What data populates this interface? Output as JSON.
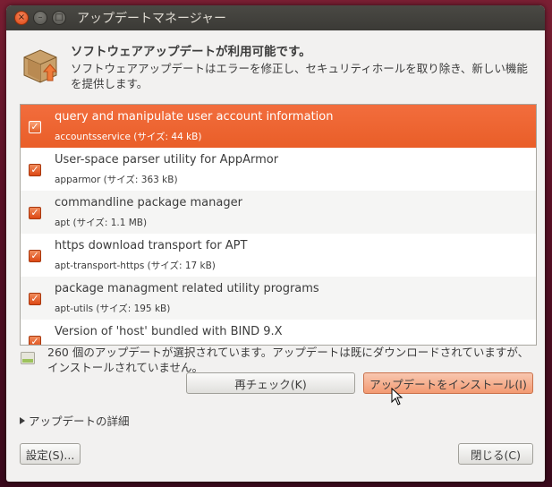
{
  "window": {
    "title": "アップデートマネージャー"
  },
  "header": {
    "heading": "ソフトウェアアップデートが利用可能です。",
    "description": "ソフトウェアアップデートはエラーを修正し、セキュリティホールを取り除き、新しい機能を提供します。"
  },
  "updates": [
    {
      "title": "query and manipulate user account information",
      "subtitle": "accountsservice (サイズ: 44 kB)"
    },
    {
      "title": "User-space parser utility for AppArmor",
      "subtitle": "apparmor (サイズ: 363 kB)"
    },
    {
      "title": "commandline package manager",
      "subtitle": "apt (サイズ: 1.1 MB)"
    },
    {
      "title": "https download transport for APT",
      "subtitle": "apt-transport-https (サイズ: 17 kB)"
    },
    {
      "title": "package managment related utility programs",
      "subtitle": "apt-utils (サイズ: 195 kB)"
    },
    {
      "title": "Version of 'host' bundled with BIND 9.X",
      "subtitle": ""
    }
  ],
  "status": {
    "text": "260 個のアップデートが選択されています。アップデートは既にダウンロードされていますが、インストールされていません。"
  },
  "buttons": {
    "check": "再チェック(K)",
    "install": "アップデートをインストール(I)",
    "settings": "設定(S)...",
    "close": "閉じる(C)"
  },
  "details_label": "アップデートの詳細",
  "colors": {
    "accent": "#e95e28",
    "titlebar": "#3b3a36",
    "window_bg": "#f2f1f0"
  }
}
